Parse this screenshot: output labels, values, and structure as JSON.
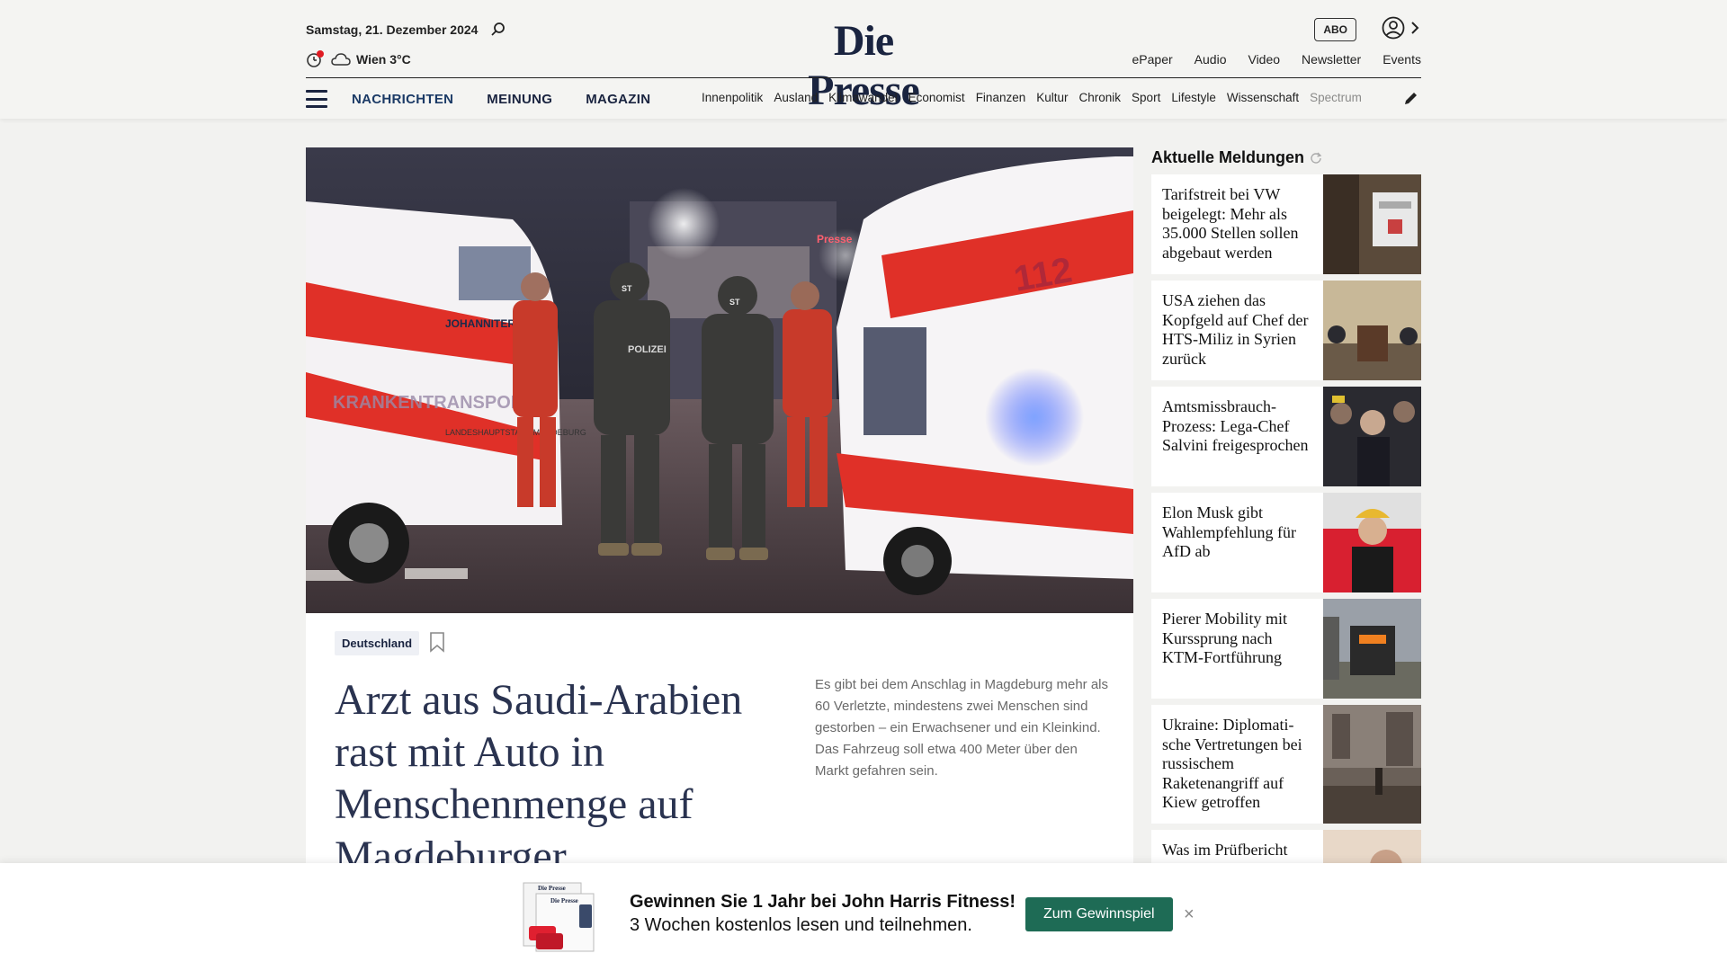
{
  "header": {
    "date": "Samstag, 21. Dezember 2024",
    "weather": "Wien 3°C",
    "logo": "Die Presse",
    "abo_label": "ABO",
    "top_links": [
      "ePaper",
      "Audio",
      "Video",
      "Newsletter",
      "Events"
    ],
    "main_nav": [
      "NACHRICHTEN",
      "MEINUNG",
      "MAGAZIN"
    ],
    "sub_nav": [
      "Innenpolitik",
      "Ausland",
      "Klimawandel",
      "Economist",
      "Finanzen",
      "Kultur",
      "Chronik",
      "Sport",
      "Lifestyle",
      "Wissenschaft",
      "Spectrum"
    ]
  },
  "hero": {
    "image_text": {
      "van_left": "JOHANNITER",
      "transport": "KRANKENTRANSPORT",
      "city": "LANDESHAUPTSTADT MAGDEBURG",
      "police": "POLIZEI",
      "helmet": "ST",
      "van_right": "112",
      "brand_sign": "Presse"
    }
  },
  "article": {
    "tag": "Deutschland",
    "headline": "Arzt aus Saudi-Arabien rast mit Auto in Menschenmenge auf Magdeburger",
    "lead": "Es gibt bei dem Anschlag in Magdeburg mehr als 60 Verletzte, mindestens zwei Menschen sind gestorben – ein Erwachsener und ein Kleinkind. Das Fahrzeug soll etwa 400 Meter über den Markt gefahren sein."
  },
  "sidebar": {
    "title": "Aktuelle Meldungen",
    "items": [
      {
        "title": "Tarifstreit bei VW beigelegt: Mehr als 35.000 Stellen sollen abgebaut werden"
      },
      {
        "title": "USA ziehen das Kopfgeld auf Chef der HTS-Miliz in Syrien zurück"
      },
      {
        "title": "Amtsmissbrauch-Prozess: Lega-Chef Salvini freigesprochen"
      },
      {
        "title": "Elon Musk gibt Wahlempfehlung für AfD ab"
      },
      {
        "title": "Pierer Mobility mit Kurssprung nach KTM-Fortführung"
      },
      {
        "title": "Ukraine: Diplomati-sche Vertretungen bei russischem Raketenangriff auf Kiew getroffen"
      },
      {
        "title": "Was im Prüfbericht"
      }
    ]
  },
  "promo": {
    "line1": "Gewinnen Sie 1 Jahr bei John Harris Fitness!",
    "line2": "3 Wochen kostenlos lesen und teilnehmen.",
    "button": "Zum Gewinnspiel",
    "close": "×",
    "image_logo": "Die Presse"
  },
  "colors": {
    "brand": "#1a2440",
    "promo_button": "#1e6b55"
  }
}
